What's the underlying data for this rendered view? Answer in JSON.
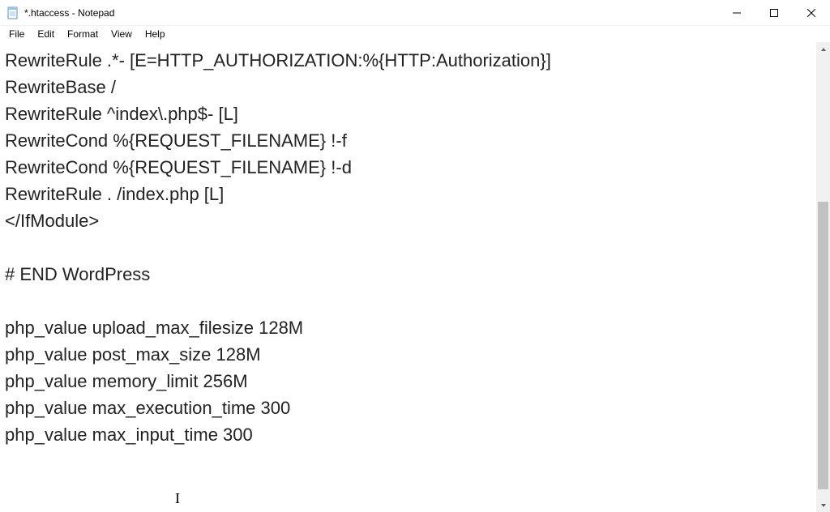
{
  "window": {
    "title": "*.htaccess - Notepad"
  },
  "menu": {
    "file": "File",
    "edit": "Edit",
    "format": "Format",
    "view": "View",
    "help": "Help"
  },
  "editor": {
    "content": "RewriteRule .*- [E=HTTP_AUTHORIZATION:%{HTTP:Authorization}]\nRewriteBase /\nRewriteRule ^index\\.php$- [L]\nRewriteCond %{REQUEST_FILENAME} !-f\nRewriteCond %{REQUEST_FILENAME} !-d\nRewriteRule . /index.php [L]\n</IfModule>\n\n# END WordPress\n\nphp_value upload_max_filesize 128M\nphp_value post_max_size 128M\nphp_value memory_limit 256M\nphp_value max_execution_time 300\nphp_value max_input_time 300"
  }
}
